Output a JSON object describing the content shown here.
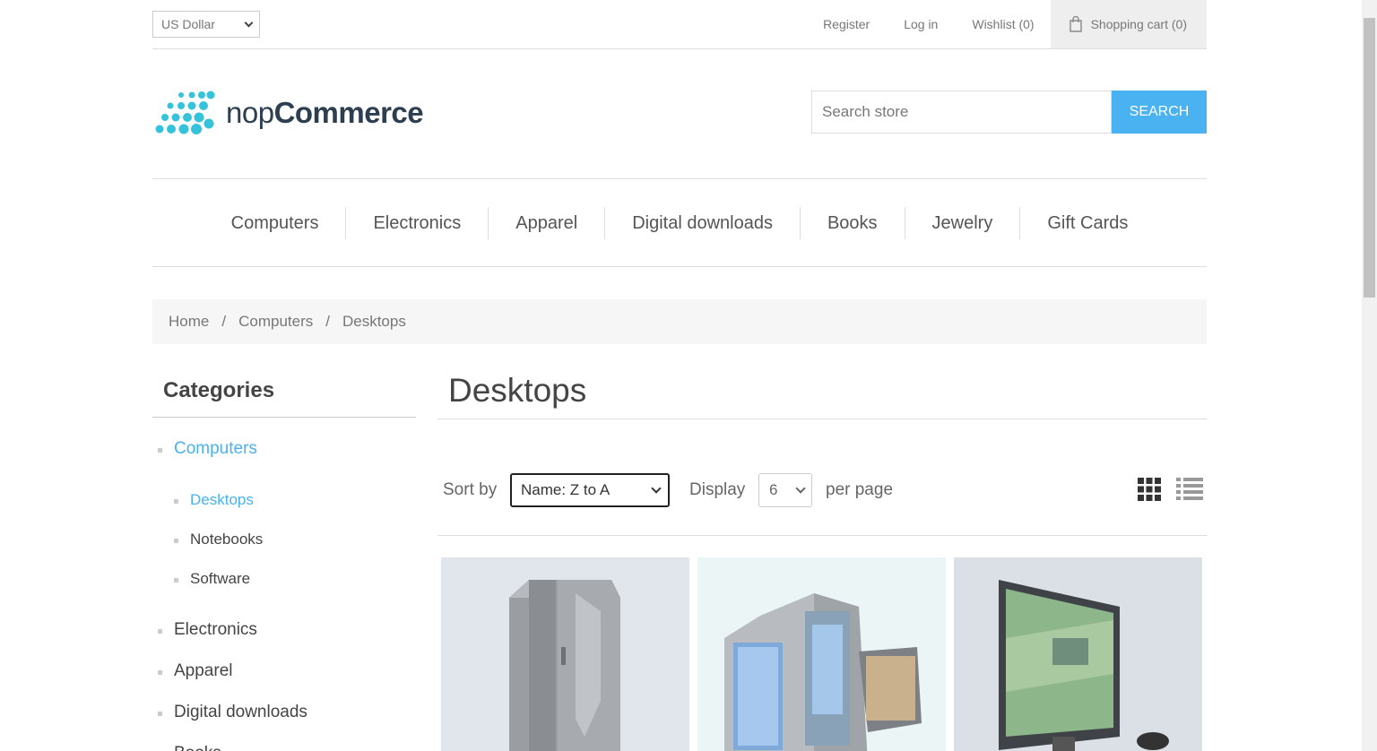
{
  "header": {
    "currency": "US Dollar",
    "links": {
      "register": "Register",
      "login": "Log in",
      "wishlist": "Wishlist (0)",
      "cart": "Shopping cart (0)"
    }
  },
  "logo": {
    "part1": "nop",
    "part2": "Commerce"
  },
  "search": {
    "placeholder": "Search store",
    "button": "Search"
  },
  "menu": [
    "Computers",
    "Electronics",
    "Apparel",
    "Digital downloads",
    "Books",
    "Jewelry",
    "Gift Cards"
  ],
  "breadcrumb": [
    "Home",
    "Computers",
    "Desktops"
  ],
  "breadcrumb_separator": "/",
  "sidebar": {
    "title": "Categories",
    "items": [
      "Computers",
      "Electronics",
      "Apparel",
      "Digital downloads",
      "Books"
    ],
    "subitems": [
      "Desktops",
      "Notebooks",
      "Software"
    ]
  },
  "main": {
    "title": "Desktops",
    "sort_label": "Sort by",
    "sort_value": "Name: Z to A",
    "display_label": "Display",
    "display_value": "6",
    "per_page": "per page"
  },
  "colors": {
    "accent": "#4ab2f1",
    "logo_dots": "#35c3db"
  }
}
